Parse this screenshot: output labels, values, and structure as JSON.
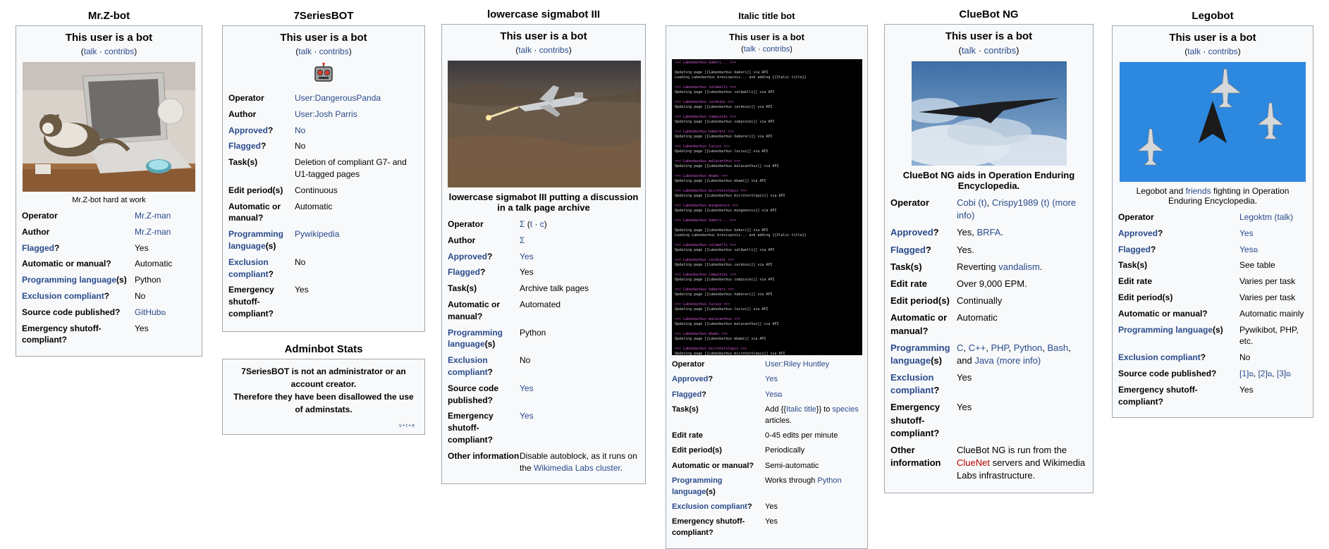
{
  "c1": {
    "title": "Mr.Z-bot",
    "head": "This user is a bot",
    "talk": "talk",
    "sep": "·",
    "contribs": "contribs",
    "caption": "Mr.Z-bot hard at work",
    "rows": [
      {
        "label": "Operator",
        "value": "Mr.Z-man"
      },
      {
        "label": "Author",
        "value": "Mr.Z-man"
      },
      {
        "label_link": "Flagged",
        "label_suffix": "?",
        "value": "Yes"
      },
      {
        "label": "Automatic or manual?",
        "value": "Automatic"
      },
      {
        "label_link": "Programming language",
        "label_suffix": "(s)",
        "value": "Python"
      },
      {
        "label_link": "Exclusion compliant",
        "label_suffix": "?",
        "value": "No"
      },
      {
        "label": "Source code published?",
        "value": "GitHub"
      },
      {
        "label": "Emergency shutoff-compliant?",
        "value": "Yes"
      }
    ]
  },
  "c2": {
    "title": "7SeriesBOT",
    "head": "This user is a bot",
    "talk": "talk",
    "sep": "·",
    "contribs": "contribs",
    "rows": [
      {
        "label": "Operator",
        "value": "User:DangerousPanda"
      },
      {
        "label": "Author",
        "value": "User:Josh Parris"
      },
      {
        "label_link": "Approved",
        "label_suffix": "?",
        "value": "No"
      },
      {
        "label_link": "Flagged",
        "label_suffix": "?",
        "value": "No"
      },
      {
        "label": "Task(s)",
        "value": "Deletion of compliant G7- and U1-tagged pages"
      },
      {
        "label": "Edit period(s)",
        "value": "Continuous"
      },
      {
        "label": "Automatic or manual?",
        "value": "Automatic"
      },
      {
        "label_link": "Programming language",
        "label_suffix": "(s)",
        "value": "Pywikipedia"
      },
      {
        "label_link": "Exclusion compliant",
        "label_suffix": "?",
        "value": "No"
      },
      {
        "label": "Emergency shutoff-compliant?",
        "value": "Yes"
      }
    ],
    "stats_title": "Adminbot Stats",
    "stats_line1": "7SeriesBOT is not an administrator or an account creator.",
    "stats_line2": "Therefore they have been disallowed the use of adminstats.",
    "stats_vte": "v • t • e"
  },
  "c3": {
    "title": "lowercase sigmabot III",
    "head": "This user is a bot",
    "talk": "talk",
    "sep": "·",
    "contribs": "contribs",
    "caption": "lowercase sigmabot III putting a discussion in a talk page archive",
    "operator_sigma": "Σ",
    "operator_t": "t",
    "operator_c": "c",
    "operator_dot": "·",
    "rows": [
      {
        "label": "Author",
        "value": "Σ"
      },
      {
        "label_link": "Approved",
        "label_suffix": "?",
        "value": "Yes"
      },
      {
        "label_link": "Flagged",
        "label_suffix": "?",
        "value": "Yes"
      },
      {
        "label": "Task(s)",
        "value": "Archive talk pages"
      },
      {
        "label": "Automatic or manual?",
        "value": "Automated"
      },
      {
        "label_link": "Programming language",
        "label_suffix": "(s)",
        "value": "Python"
      },
      {
        "label_link": "Exclusion compliant",
        "label_suffix": "?",
        "value": "No"
      },
      {
        "label": "Source code published?",
        "value": "Yes"
      },
      {
        "label": "Emergency shutoff-compliant?",
        "value": "Yes"
      }
    ],
    "other_label": "Other information",
    "other_pre": "Disable autoblock, as it runs on the ",
    "other_link": "Wikimedia Labs cluster",
    "other_post": "."
  },
  "c4": {
    "title": "Italic title bot",
    "head": "This user is a bot",
    "talk": "talk",
    "sep": "·",
    "contribs": "contribs",
    "rows": [
      {
        "label": "Operator",
        "value": "User:Riley Huntley"
      },
      {
        "label_link": "Approved",
        "label_suffix": "?",
        "value": "Yes"
      },
      {
        "label_link": "Flagged",
        "label_suffix": "?",
        "value": "Yes"
      }
    ],
    "task_label": "Task(s)",
    "task_pre": "Add {{",
    "task_link1": "Italic title",
    "task_mid": "}} to ",
    "task_link2": "species",
    "task_post": " articles.",
    "rows2": [
      {
        "label": "Edit rate",
        "value": "0-45 edits per minute"
      },
      {
        "label": "Edit period(s)",
        "value": "Periodically"
      },
      {
        "label": "Automatic or manual?",
        "value": "Semi-automatic"
      }
    ],
    "lang_label": "Programming language",
    "lang_suffix": "(s)",
    "lang_pre": "Works through ",
    "lang_link": "Python",
    "rows3": [
      {
        "label_link": "Exclusion compliant",
        "label_suffix": "?",
        "value": "Yes"
      },
      {
        "label": "Emergency shutoff-compliant?",
        "value": "Yes"
      }
    ]
  },
  "c5": {
    "title": "ClueBot NG",
    "head": "This user is a bot",
    "talk": "talk",
    "sep": "·",
    "contribs": "contribs",
    "caption": "ClueBot NG aids in Operation Enduring Encyclopedia.",
    "op_label": "Operator",
    "op_a": "Cobi",
    "op_a_t": "(t)",
    "op_comma": ", ",
    "op_b": "Crispy1989",
    "op_b_t": "(t)",
    "op_more": "(more info)",
    "appr_label": "Approved",
    "appr_suffix": "?",
    "appr_pre": "Yes, ",
    "appr_link": "BRFA",
    "appr_post": ".",
    "rows": [
      {
        "label_link": "Flagged",
        "label_suffix": "?",
        "value": "Yes."
      }
    ],
    "task_label": "Task(s)",
    "task_pre": "Reverting ",
    "task_link": "vandalism",
    "task_post": ".",
    "rows2": [
      {
        "label": "Edit rate",
        "value": "Over 9,000 EPM."
      },
      {
        "label": "Edit period(s)",
        "value": "Continually"
      },
      {
        "label": "Automatic or manual?",
        "value": "Automatic"
      }
    ],
    "lang_label": "Programming language",
    "lang_suffix": "(s)",
    "langs": [
      "C",
      "C++",
      "PHP",
      "Python",
      "Bash"
    ],
    "lang_and": "and ",
    "lang_java": "Java",
    "lang_more": "(more info)",
    "rows3": [
      {
        "label_link": "Exclusion compliant",
        "label_suffix": "?",
        "value": "Yes"
      },
      {
        "label": "Emergency shutoff-compliant?",
        "value": "Yes"
      }
    ],
    "other_label": "Other information",
    "other_pre": "ClueBot NG is run from the ",
    "other_link": "ClueNet",
    "other_post": " servers and Wikimedia Labs infrastructure."
  },
  "c6": {
    "title": "Legobot",
    "head": "This user is a bot",
    "talk": "talk",
    "sep": "·",
    "contribs": "contribs",
    "cap_pre": "Legobot and ",
    "cap_link": "friends",
    "cap_post": " fighting in Operation Enduring Encyclopedia.",
    "op_label": "Operator",
    "op_val": "Legoktm",
    "op_talk": "(talk)",
    "rows": [
      {
        "label_link": "Approved",
        "label_suffix": "?",
        "value": "Yes"
      },
      {
        "label_link": "Flagged",
        "label_suffix": "?",
        "value": "Yes"
      },
      {
        "label": "Task(s)",
        "value": "See table"
      },
      {
        "label": "Edit rate",
        "value": "Varies per task"
      },
      {
        "label": "Edit period(s)",
        "value": "Varies per task"
      },
      {
        "label": "Automatic or manual?",
        "value": "Automatic mainly"
      },
      {
        "label_link": "Programming language",
        "label_suffix": "(s)",
        "value": "Pywikibot, PHP, etc."
      },
      {
        "label_link": "Exclusion compliant",
        "label_suffix": "?",
        "value": "No"
      }
    ],
    "src_label": "Source code published?",
    "src_1": "[1]",
    "src_2": "[2]",
    "src_3": "[3]",
    "emerg_label": "Emergency shutoff-compliant?",
    "emerg_val": "Yes"
  },
  "terminal_lines": [
    "<<< Labeobarbus bakeri... >>>",
    "Updating page [[Labeobarbus bakeri]] via API",
    "Loading Labeobarbus brevispinis... and adding {{Italic title}}",
    "<<< Labeobarbus caldwelli >>>",
    "Updating page [[Labeobarbus caldwelli]] via API",
    "<<< Labeobarbus cardozoi >>>",
    "Updating page [[Labeobarbus cardozoi]] via API",
    "<<< Labeobarbus compiniei >>>",
    "Updating page [[Labeobarbus compiniei]] via API",
    "<<< Labeobarbus habereri >>>",
    "Updating page [[Labeobarbus habereri]] via API",
    "<<< Labeobarbus lucius >>>",
    "Updating page [[Labeobarbus lucius]] via API",
    "<<< Labeobarbus malacanthus >>>",
    "Updating page [[Labeobarbus malacanthus]] via API",
    "<<< Labeobarbus mbami >>>",
    "Updating page [[Labeobarbus mbami]] via API",
    "<<< Labeobarbus microterolepis >>>",
    "Updating page [[Labeobarbus microterolepis]] via API",
    "<<< Labeobarbus mungoensis >>>",
    "Updating page [[Labeobarbus mungoensis]] via API"
  ]
}
